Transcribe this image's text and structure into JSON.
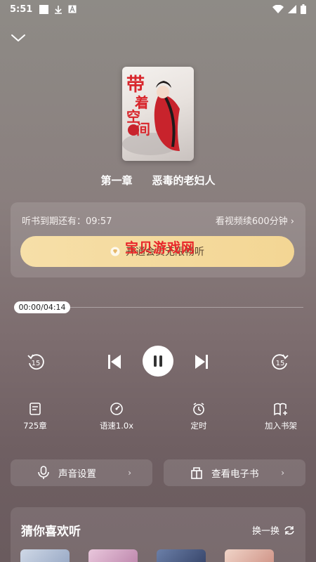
{
  "status_bar": {
    "time": "5:51"
  },
  "chapter": {
    "number": "第一章",
    "name": "恶毒的老妇人"
  },
  "vip": {
    "remaining_label": "听书到期还有：09:57",
    "watch_video": "看视频续600分钟",
    "open_vip": "开通会员无限畅听",
    "watermark": "宝贝游戏网"
  },
  "player": {
    "position_text": "00:00/04:14",
    "progress": 0
  },
  "tools": {
    "chapters": "725章",
    "speed": "语速1.0x",
    "timer": "定时",
    "bookshelf": "加入书架"
  },
  "actions": {
    "voice_settings": "声音设置",
    "ebook": "查看电子书",
    "chevron": "›"
  },
  "recommend": {
    "title": "猜你喜欢听",
    "refresh": "换一换"
  },
  "colors": {
    "vip_gold": "#f6dfa8",
    "watermark_red": "#e8262a"
  }
}
